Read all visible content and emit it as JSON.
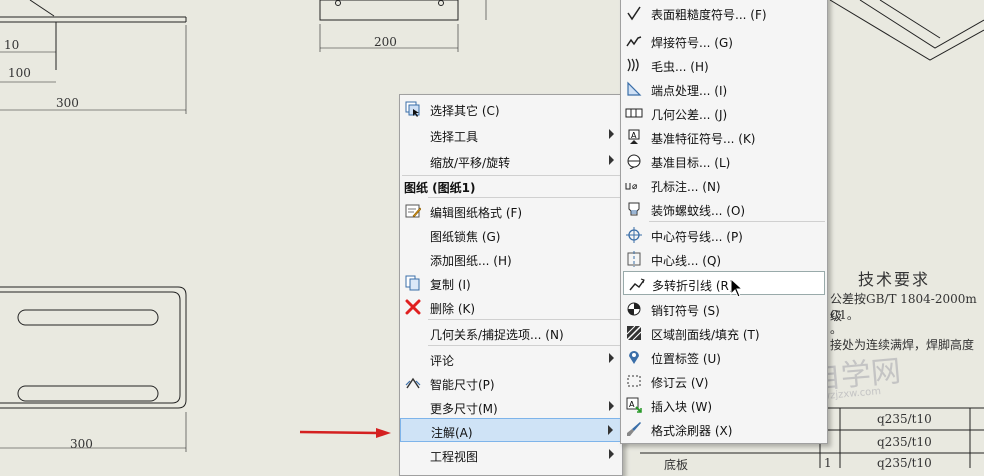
{
  "drawing": {
    "dims": {
      "d10": "10",
      "d100": "100",
      "d300_top": "300",
      "d200": "200",
      "d300_bottom": "300"
    },
    "tech": {
      "title": "技术要求",
      "line1": "公差按GB/T 1804-2000m级",
      "line2": "C1。",
      "line3": "。",
      "line4": "接处为连续满焊，焊脚高度"
    },
    "table": {
      "rows": [
        {
          "cells": [
            "",
            "q235/t10"
          ]
        },
        {
          "cells": [
            "",
            "q235/t10"
          ]
        },
        {
          "cells": [
            "底板",
            "1",
            "q235/t10"
          ]
        }
      ]
    }
  },
  "watermark": {
    "main": "SW自学网",
    "url": "www.swzjzxw.com"
  },
  "context_menu": {
    "select_other": "选择其它 (C)",
    "select_tools": "选择工具",
    "zoom_pan_rotate": "缩放/平移/旋转",
    "section_header": "图纸 (图纸1)",
    "edit_sheet_format": "编辑图纸格式 (F)",
    "lock_sheet_focus": "图纸锁焦 (G)",
    "add_sheet": "添加图纸... (H)",
    "copy": "复制 (I)",
    "delete": "删除 (K)",
    "relations_snaps": "几何关系/捕捉选项... (N)",
    "comment": "评论",
    "smart_dimension": "智能尺寸(P)",
    "more_dimensions": "更多尺寸(M)",
    "annotations": "注解(A)",
    "drawing_views": "工程视图"
  },
  "submenu": {
    "surface_finish": "表面粗糙度符号... (F)",
    "weld_symbol": "焊接符号... (G)",
    "hatch": "毛虫... (H)",
    "end_treatment": "端点处理... (I)",
    "gtol": "几何公差... (J)",
    "datum_feature": "基准特征符号... (K)",
    "datum_target": "基准目标... (L)",
    "hole_callout": "孔标注... (N)",
    "cosmetic_thread": "装饰螺蚊线... (O)",
    "center_mark": "中心符号线... (P)",
    "centerline": "中心线... (Q)",
    "multi_jog_leader": "多转折引线 (R)",
    "dowel_pin": "销钉符号 (S)",
    "area_hatch": "区域剖面线/填充 (T)",
    "location_label": "位置标签 (U)",
    "revision_cloud": "修订云 (V)",
    "insert_block": "插入块 (W)",
    "format_painter": "格式涂刷器 (X)"
  },
  "colors": {
    "arrow": "#d42020",
    "highlight": "#cfe3f6",
    "watermark": "#bdbdbd"
  }
}
